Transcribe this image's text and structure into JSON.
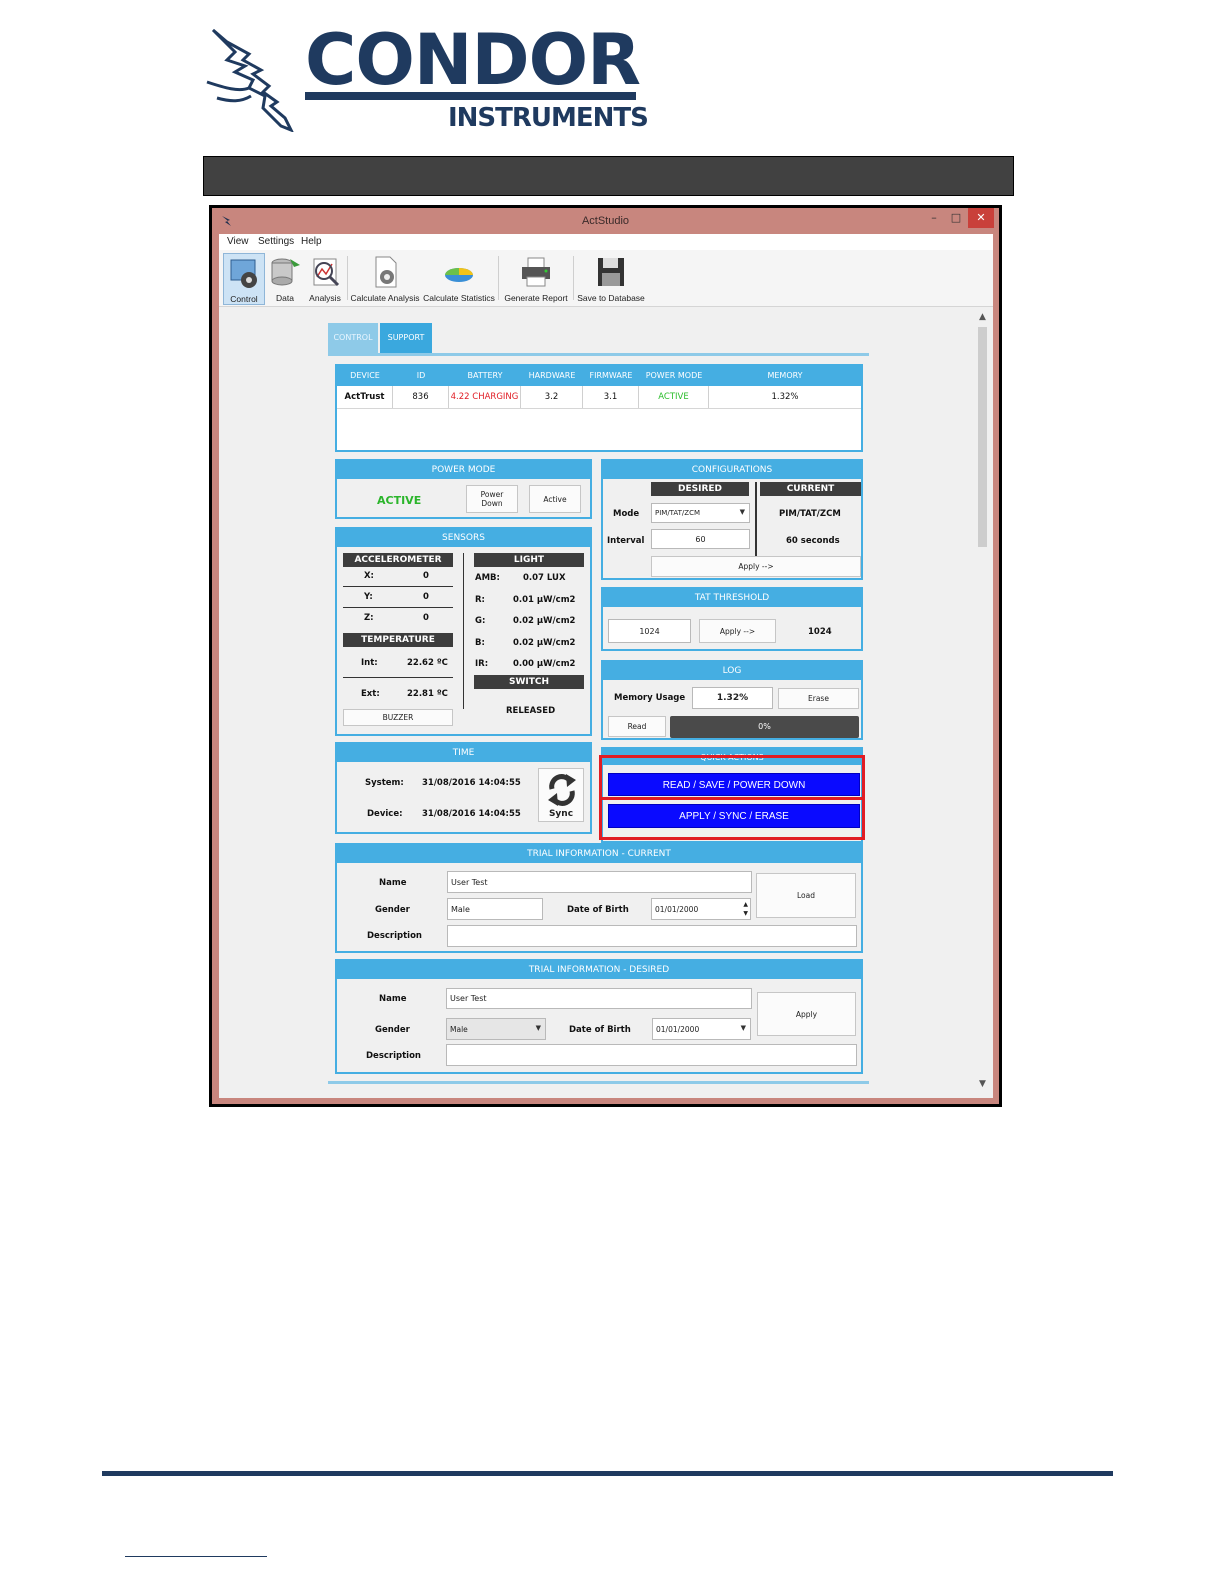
{
  "logo": {
    "brand": "CONDOR",
    "sub": "INSTRUMENTS"
  },
  "window": {
    "title": "ActStudio",
    "controls": {
      "minimize": "–",
      "maximize": "□",
      "close": "✕"
    }
  },
  "menu": [
    "View",
    "Settings",
    "Help"
  ],
  "toolbar": [
    {
      "label": "Control",
      "icon": "control-icon",
      "active": true
    },
    {
      "label": "Data",
      "icon": "database-icon"
    },
    {
      "label": "Analysis",
      "icon": "analysis-icon"
    },
    {
      "label": "Calculate Analysis",
      "icon": "calculate-analysis-icon"
    },
    {
      "label": "Calculate Statistics",
      "icon": "statistics-icon"
    },
    {
      "label": "Generate Report",
      "icon": "printer-icon"
    },
    {
      "label": "Save to Database",
      "icon": "floppy-disk-icon"
    }
  ],
  "tabs": [
    "CONTROL",
    "SUPPORT"
  ],
  "device_table": {
    "headers": [
      "DEVICE",
      "ID",
      "BATTERY",
      "HARDWARE",
      "FIRMWARE",
      "POWER MODE",
      "MEMORY"
    ],
    "row": [
      "ActTrust",
      "836",
      "4.22 CHARGING",
      "3.2",
      "3.1",
      "ACTIVE",
      "1.32%"
    ]
  },
  "power_mode": {
    "title": "POWER MODE",
    "status": "ACTIVE",
    "power_down": "Power Down",
    "active": "Active"
  },
  "sensors": {
    "title": "SENSORS",
    "accelerometer": {
      "title": "ACCELEROMETER",
      "x_label": "X:",
      "x": "0",
      "y_label": "Y:",
      "y": "0",
      "z_label": "Z:",
      "z": "0"
    },
    "temperature": {
      "title": "TEMPERATURE",
      "int_label": "Int:",
      "int": "22.62 ºC",
      "ext_label": "Ext:",
      "ext": "22.81 ºC"
    },
    "buzzer": "BUZZER",
    "light": {
      "title": "LIGHT",
      "amb_label": "AMB:",
      "amb": "0.07 LUX",
      "r_label": "R:",
      "r": "0.01 µW/cm2",
      "g_label": "G:",
      "g": "0.02 µW/cm2",
      "b_label": "B:",
      "b": "0.02 µW/cm2",
      "ir_label": "IR:",
      "ir": "0.00 µW/cm2"
    },
    "switch": {
      "title": "SWITCH",
      "state": "RELEASED"
    }
  },
  "time": {
    "title": "TIME",
    "system_label": "System:",
    "system": "31/08/2016 14:04:55",
    "device_label": "Device:",
    "device": "31/08/2016 14:04:55",
    "sync": "Sync"
  },
  "configurations": {
    "title": "CONFIGURATIONS",
    "desired": "DESIRED",
    "current": "CURRENT",
    "mode_label": "Mode",
    "mode_desired": "PIM/TAT/ZCM",
    "mode_current": "PIM/TAT/ZCM",
    "interval_label": "Interval",
    "interval_desired": "60",
    "interval_current": "60 seconds",
    "apply": "Apply -->"
  },
  "tat_threshold": {
    "title": "TAT THRESHOLD",
    "desired": "1024",
    "apply": "Apply -->",
    "current": "1024"
  },
  "log": {
    "title": "LOG",
    "memory_label": "Memory Usage",
    "memory": "1.32%",
    "erase": "Erase",
    "read": "Read",
    "progress": "0%",
    "progress_value": 0
  },
  "quick_actions": {
    "title": "QUICK ACTIONS",
    "read_save": "READ / SAVE / POWER DOWN",
    "apply_sync": "APPLY / SYNC / ERASE"
  },
  "trial_current": {
    "title": "TRIAL INFORMATION - CURRENT",
    "name_label": "Name",
    "name": "User Test",
    "gender_label": "Gender",
    "gender": "Male",
    "dob_label": "Date of Birth",
    "dob": "01/01/2000",
    "description_label": "Description",
    "description": "",
    "load": "Load"
  },
  "trial_desired": {
    "title": "TRIAL INFORMATION - DESIRED",
    "name_label": "Name",
    "name": "User Test",
    "gender_label": "Gender",
    "gender": "Male",
    "dob_label": "Date of Birth",
    "dob": "01/01/2000",
    "description_label": "Description",
    "description": "",
    "apply": "Apply"
  },
  "colors": {
    "panel_blue": "#45aee2",
    "battery_red": "#e01c24",
    "active_green": "#2bbd2b",
    "quick_blue": "#0a0aff",
    "highlight_red": "#e01c24",
    "brand_navy": "#1f3a5f"
  }
}
